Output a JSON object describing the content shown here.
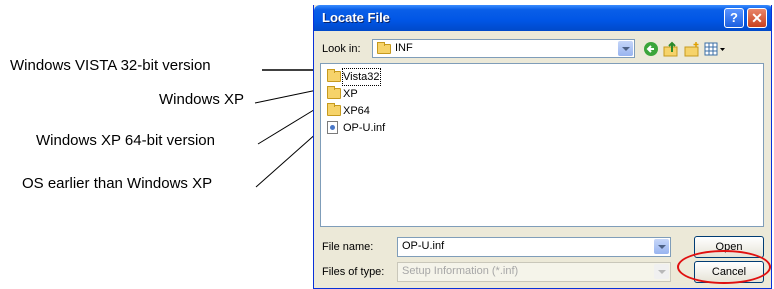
{
  "annotations": {
    "vista32": "Windows VISTA 32-bit version",
    "xp": "Windows XP",
    "xp64": "Windows XP 64-bit version",
    "earlier": "OS earlier than Windows XP"
  },
  "dialog": {
    "title": "Locate File",
    "help_label": "?",
    "close_label": "✕",
    "look_in_label": "Look in:",
    "look_in_value": "INF",
    "toolbar_icons": [
      "back-icon",
      "up-folder-icon",
      "new-folder-icon",
      "view-menu-icon"
    ],
    "files": [
      {
        "name": "Vista32",
        "type": "folder"
      },
      {
        "name": "XP",
        "type": "folder"
      },
      {
        "name": "XP64",
        "type": "folder"
      },
      {
        "name": "OP-U.inf",
        "type": "file"
      }
    ],
    "file_name_label": "File name:",
    "file_name_value": "OP-U.inf",
    "files_of_type_label": "Files of type:",
    "files_of_type_value": "Setup Information (*.inf)",
    "open_label": "Open",
    "cancel_label": "Cancel"
  },
  "colors": {
    "title_bar": "#0055e5",
    "highlight_ring": "#e01010",
    "dialog_bg": "#ece9d8"
  }
}
